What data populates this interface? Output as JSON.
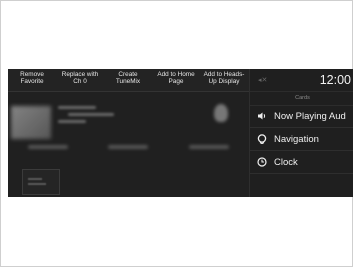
{
  "action_bar": {
    "items": [
      {
        "label": "Remove\nFavorite"
      },
      {
        "label": "Replace with\nCh 0"
      },
      {
        "label": "Create\nTuneMix"
      },
      {
        "label": "Add to Home\nPage"
      },
      {
        "label": "Add to Heads-\nUp Display"
      }
    ]
  },
  "status_bar": {
    "time": "12:00"
  },
  "cards_panel": {
    "header": "Cards",
    "items": [
      {
        "label": "Now Playing Aud",
        "icon": "speaker-icon"
      },
      {
        "label": "Navigation",
        "icon": "navigation-pin-icon"
      },
      {
        "label": "Clock",
        "icon": "clock-icon"
      }
    ]
  }
}
